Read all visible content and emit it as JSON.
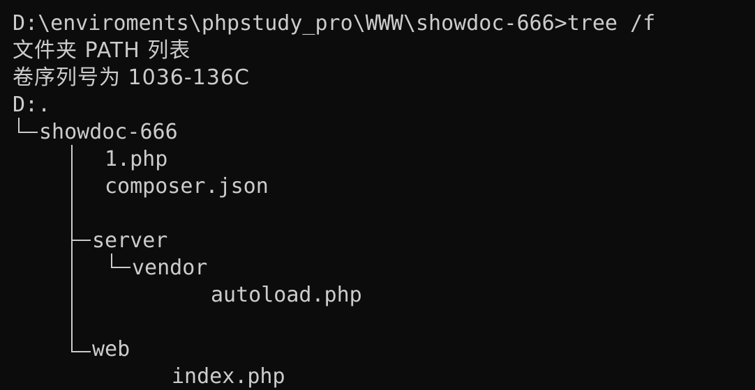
{
  "terminal": {
    "prompt_command": "D:\\enviroments\\phpstudy_pro\\WWW\\showdoc-666>tree /f",
    "header_folder": "文件夹 PATH 列表",
    "header_serial": "卷序列号为 1036-136C",
    "root_drive": "D:.",
    "tree": {
      "root_folder": "showdoc-666",
      "file_1": "1.php",
      "file_composer": "composer.json",
      "folder_server": "server",
      "folder_vendor": "vendor",
      "file_autoload": "autoload.php",
      "folder_web": "web",
      "file_index": "index.php"
    },
    "colors": {
      "background": "#0c0c0c",
      "foreground": "#cccccc"
    }
  }
}
